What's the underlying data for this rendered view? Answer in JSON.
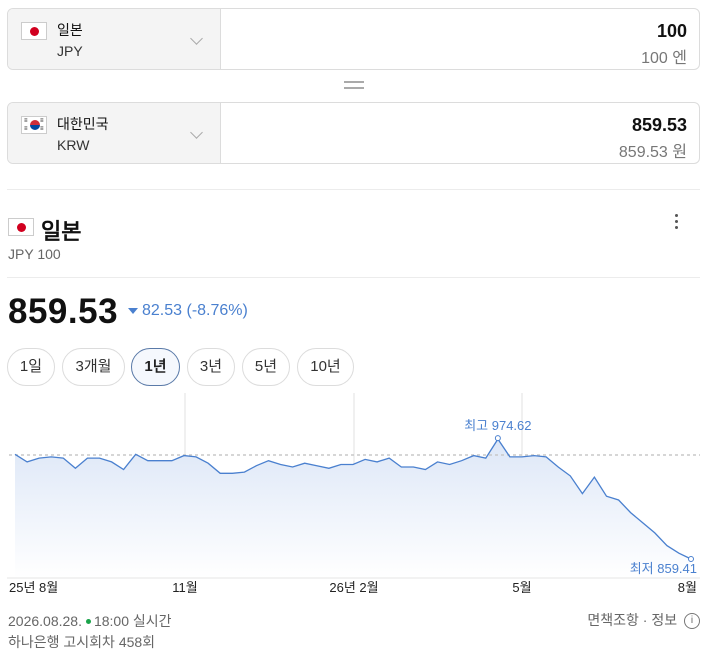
{
  "converter": {
    "from": {
      "name": "일본",
      "code": "JPY",
      "amount": "100",
      "amount_text": "100 엔"
    },
    "to": {
      "name": "대한민국",
      "code": "KRW",
      "amount": "859.53",
      "amount_text": "859.53 원"
    }
  },
  "header": {
    "title": "일본",
    "subtitle": "JPY 100"
  },
  "price": {
    "value": "859.53",
    "change": "82.53 (-8.76%)",
    "direction": "down"
  },
  "periods": [
    "1일",
    "3개월",
    "1년",
    "3년",
    "5년",
    "10년"
  ],
  "active_period": "1년",
  "chart_data": {
    "type": "area",
    "x_ticks": [
      "25년 8월",
      "11월",
      "26년 2월",
      "5월",
      "8월"
    ],
    "annotations": {
      "max_label": "최고",
      "max_value": "974.62",
      "min_label": "최저",
      "min_value": "859.41"
    },
    "ylim": [
      859.41,
      974.62
    ],
    "reference_value": 941.5,
    "values": [
      942,
      936,
      939,
      940,
      939,
      931,
      939,
      939,
      936,
      930,
      942,
      937,
      937,
      937,
      941,
      940,
      935,
      927,
      927,
      928,
      933,
      937,
      934,
      932,
      935,
      933,
      931,
      934,
      934,
      938,
      936,
      939,
      932,
      932,
      930,
      936,
      934,
      937,
      941,
      939,
      954,
      940,
      940,
      941,
      940,
      932,
      925,
      911,
      924,
      909,
      906,
      896,
      888,
      880,
      870,
      864,
      859.41
    ],
    "max_index": 40,
    "colors": {
      "line": "#4a80cf",
      "fill_top": "#dde7f7",
      "fill_bottom": "#ffffff",
      "reference": "#c8c8c8"
    }
  },
  "footer": {
    "date": "2026.08.28.",
    "time": "18:00 실시간",
    "source": "하나은행 고시회차 458회",
    "disclaimer": "면책조항 · 정보"
  },
  "colors": {
    "accent": "#4a80cf",
    "live_dot": "#1aa34a",
    "jp_red": "#d1001f"
  }
}
